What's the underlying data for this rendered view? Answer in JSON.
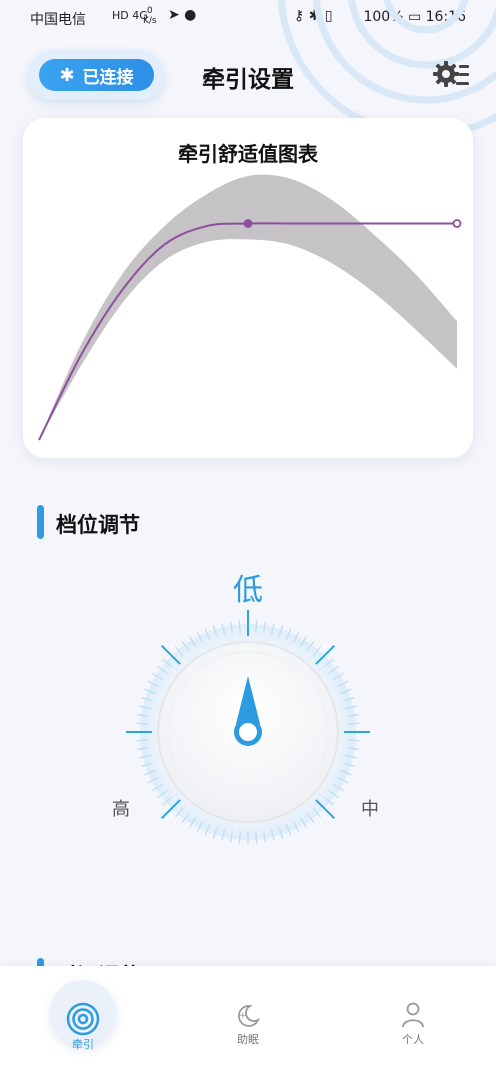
{
  "status_bar": {
    "carrier": "中国电信",
    "network": "HD 4G",
    "speed_value": "0",
    "speed_unit": "K/s",
    "battery": "100%",
    "time": "16:16"
  },
  "header": {
    "bluetooth_label": "已连接",
    "title": "牵引设置"
  },
  "chart_data": {
    "type": "area",
    "title": "牵引舒适值图表",
    "xlabel": "",
    "ylabel": "",
    "x": [
      0,
      1,
      2,
      3,
      4,
      5,
      6,
      7,
      8,
      9,
      10
    ],
    "series": [
      {
        "kind": "band-upper",
        "values": [
          0.0,
          0.36,
          0.63,
          0.81,
          0.93,
          1.0,
          0.99,
          0.91,
          0.78,
          0.63,
          0.45
        ]
      },
      {
        "kind": "band-lower",
        "values": [
          0.0,
          0.28,
          0.52,
          0.68,
          0.75,
          0.76,
          0.74,
          0.67,
          0.56,
          0.42,
          0.27
        ]
      },
      {
        "kind": "line",
        "values": [
          0.0,
          0.32,
          0.57,
          0.74,
          0.81,
          0.82,
          0.82,
          0.82,
          0.82,
          0.82,
          0.82
        ]
      }
    ],
    "markers": [
      5,
      10
    ],
    "colors": {
      "band": "#c5c3c6",
      "line": "#8e4f9c"
    }
  },
  "gear": {
    "section_title": "档位调节",
    "label_low": "低",
    "label_high": "高",
    "label_mid": "中",
    "current": "低",
    "accent": "#2d9bdf"
  },
  "next_section": {
    "title": "时间调节"
  },
  "bottom_nav": {
    "items": [
      {
        "label": "牵引",
        "icon": "traction-icon",
        "active": true
      },
      {
        "label": "助眠",
        "icon": "sleep-icon",
        "active": false
      },
      {
        "label": "个人",
        "icon": "person-icon",
        "active": false
      }
    ],
    "active_color": "#2d9bdf"
  }
}
